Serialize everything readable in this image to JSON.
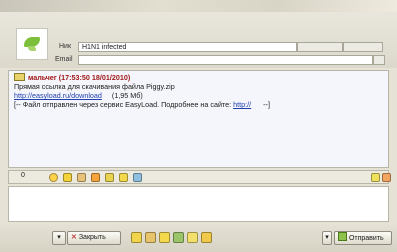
{
  "header": {
    "nick_label": "Ник",
    "nick_value": "H1N1 infected",
    "email_label": "Email",
    "email_value": ""
  },
  "message": {
    "header": "мальчег (17:53:50 18/01/2010)",
    "line1": "Прямая ссылка для скачивания файла Piggy.zip",
    "link": "http://easyload.ru/download",
    "link_suffix": "(1,95 Мб)",
    "line3_prefix": "[-- Файл отправлен через сервис EasyLoad. Подробнее на сайте:",
    "site_link": "http://",
    "line3_suffix": "--]"
  },
  "toolbar": {
    "counter": "0"
  },
  "buttons": {
    "close_label": "Закрыть",
    "send_label": "Отправить"
  },
  "colors": {
    "sender_name": "#a01818",
    "link": "#2040b0"
  }
}
